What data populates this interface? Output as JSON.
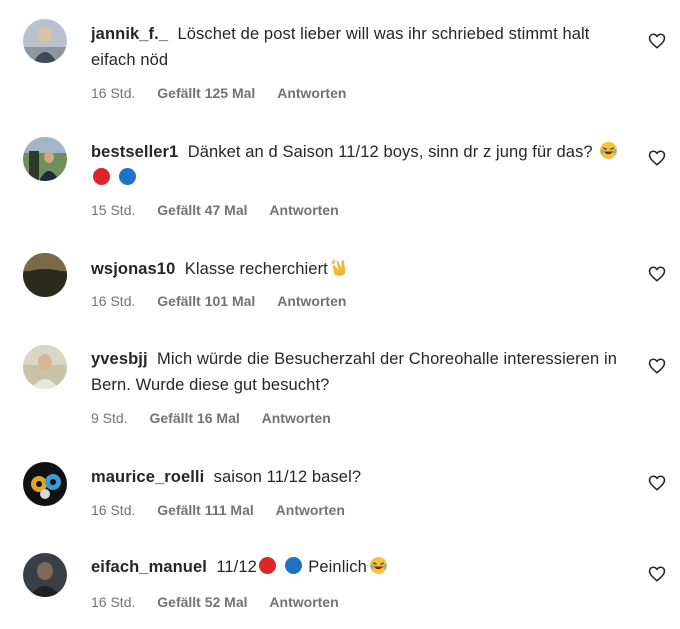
{
  "colors": {
    "red_dot": "#e0242c",
    "blue_dot": "#1f73c7",
    "meta_gray": "#737373"
  },
  "comments": [
    {
      "username": "jannik_f._",
      "text": "Löschet de post lieber will was ihr schriebed stimmt halt eifach nöd",
      "time": "16 Std.",
      "likes": "Gefällt 125 Mal",
      "reply": "Antworten",
      "avatar_icon": "avatar-photo"
    },
    {
      "username": "bestseller1",
      "text": "Dänket an d Saison 11/12 boys, sinn dr z jung für das?",
      "emojis": [
        "laughing-emoji",
        "red-circle",
        "blue-circle"
      ],
      "time": "15 Std.",
      "likes": "Gefällt 47 Mal",
      "reply": "Antworten",
      "avatar_icon": "avatar-photo"
    },
    {
      "username": "wsjonas10",
      "text": "Klasse recherchiert",
      "emojis": [
        "clapping-hands-emoji"
      ],
      "time": "16 Std.",
      "likes": "Gefällt 101 Mal",
      "reply": "Antworten",
      "avatar_icon": "avatar-photo"
    },
    {
      "username": "yvesbjj",
      "text": "Mich würde die Besucherzahl der Choreohalle interessieren in Bern. Wurde diese gut besucht?",
      "time": "9 Std.",
      "likes": "Gefällt 16 Mal",
      "reply": "Antworten",
      "avatar_icon": "avatar-photo"
    },
    {
      "username": "maurice_roelli",
      "text": "saison 11/12 basel?",
      "time": "16 Std.",
      "likes": "Gefällt 111 Mal",
      "reply": "Antworten",
      "avatar_icon": "avatar-photo"
    },
    {
      "username": "eifach_manuel",
      "text_before": "11/12",
      "text_after": "Peinlich",
      "emojis": [
        "red-circle",
        "blue-circle",
        "laughing-emoji"
      ],
      "time": "16 Std.",
      "likes": "Gefällt 52 Mal",
      "reply": "Antworten",
      "avatar_icon": "avatar-photo"
    }
  ]
}
